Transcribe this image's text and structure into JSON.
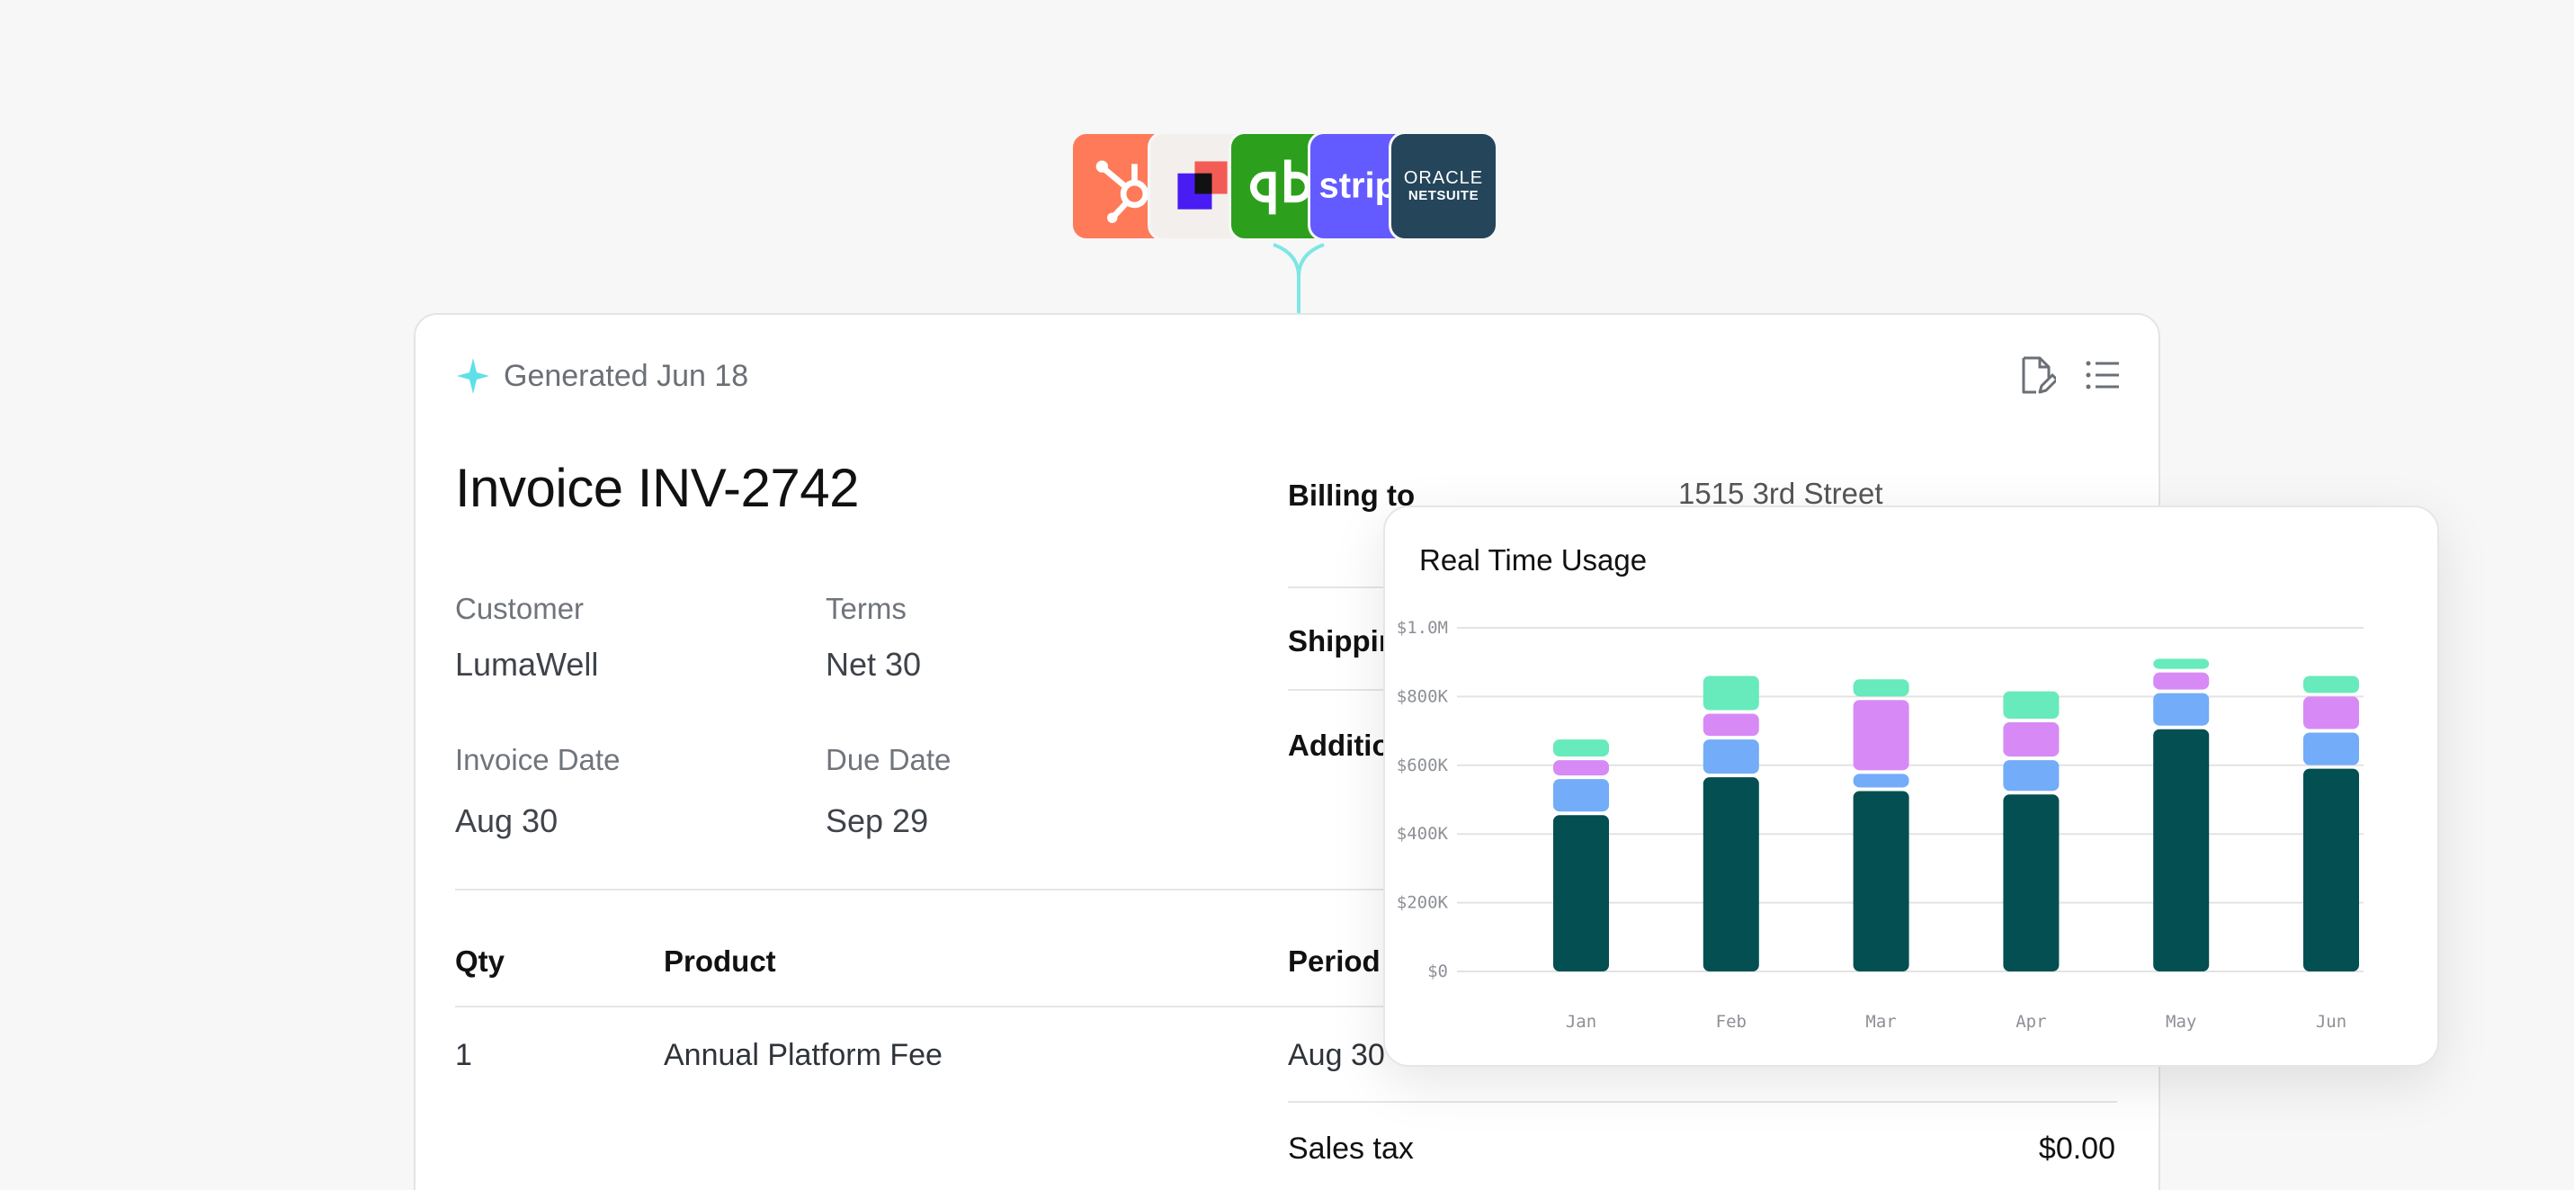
{
  "integrations": [
    {
      "name": "hubspot-logo",
      "color": "#ff7a59"
    },
    {
      "name": "frame-logo",
      "color": "#f3efec"
    },
    {
      "name": "quickbooks-logo",
      "color": "#2ca01c"
    },
    {
      "name": "stripe-logo",
      "color": "#635bff",
      "text": "strip"
    },
    {
      "name": "oracle-netsuite-logo",
      "color": "#24455a",
      "line1": "ORACLE",
      "line2": "NETSUITE"
    }
  ],
  "invoice": {
    "generated": "Generated Jun 18",
    "title": "Invoice INV-2742",
    "customer_label": "Customer",
    "customer": "LumaWell",
    "terms_label": "Terms",
    "terms": "Net 30",
    "invoice_date_label": "Invoice Date",
    "invoice_date": "Aug 30",
    "due_date_label": "Due Date",
    "due_date": "Sep 29",
    "billing_label": "Billing to",
    "billing_value": "1515 3rd Street",
    "shipping_label": "Shippin",
    "additional_label": "Additio",
    "table": {
      "headers": {
        "qty": "Qty",
        "product": "Product",
        "period": "Period"
      },
      "rows": [
        {
          "qty": "1",
          "product": "Annual Platform Fee",
          "period": "Aug 30"
        }
      ]
    },
    "sales_tax_label": "Sales tax",
    "sales_tax": "$0.00"
  },
  "chart_data": {
    "type": "bar",
    "stacked": true,
    "title": "Real Time Usage",
    "categories": [
      "Jan",
      "Feb",
      "Mar",
      "Apr",
      "May",
      "Jun"
    ],
    "y_ticks": [
      "$0",
      "$200K",
      "$400K",
      "$600K",
      "$800K",
      "$1.0M"
    ],
    "ylim": [
      0,
      1000000
    ],
    "grid": true,
    "series": [
      {
        "color": "#034f52",
        "values": [
          455000,
          565000,
          525000,
          515000,
          705000,
          590000
        ]
      },
      {
        "color": "#73acf8",
        "values": [
          105000,
          110000,
          50000,
          100000,
          105000,
          105000
        ]
      },
      {
        "color": "#d78af5",
        "values": [
          55000,
          75000,
          215000,
          110000,
          60000,
          105000
        ]
      },
      {
        "color": "#67eabc",
        "values": [
          60000,
          110000,
          60000,
          90000,
          40000,
          60000
        ]
      }
    ]
  }
}
